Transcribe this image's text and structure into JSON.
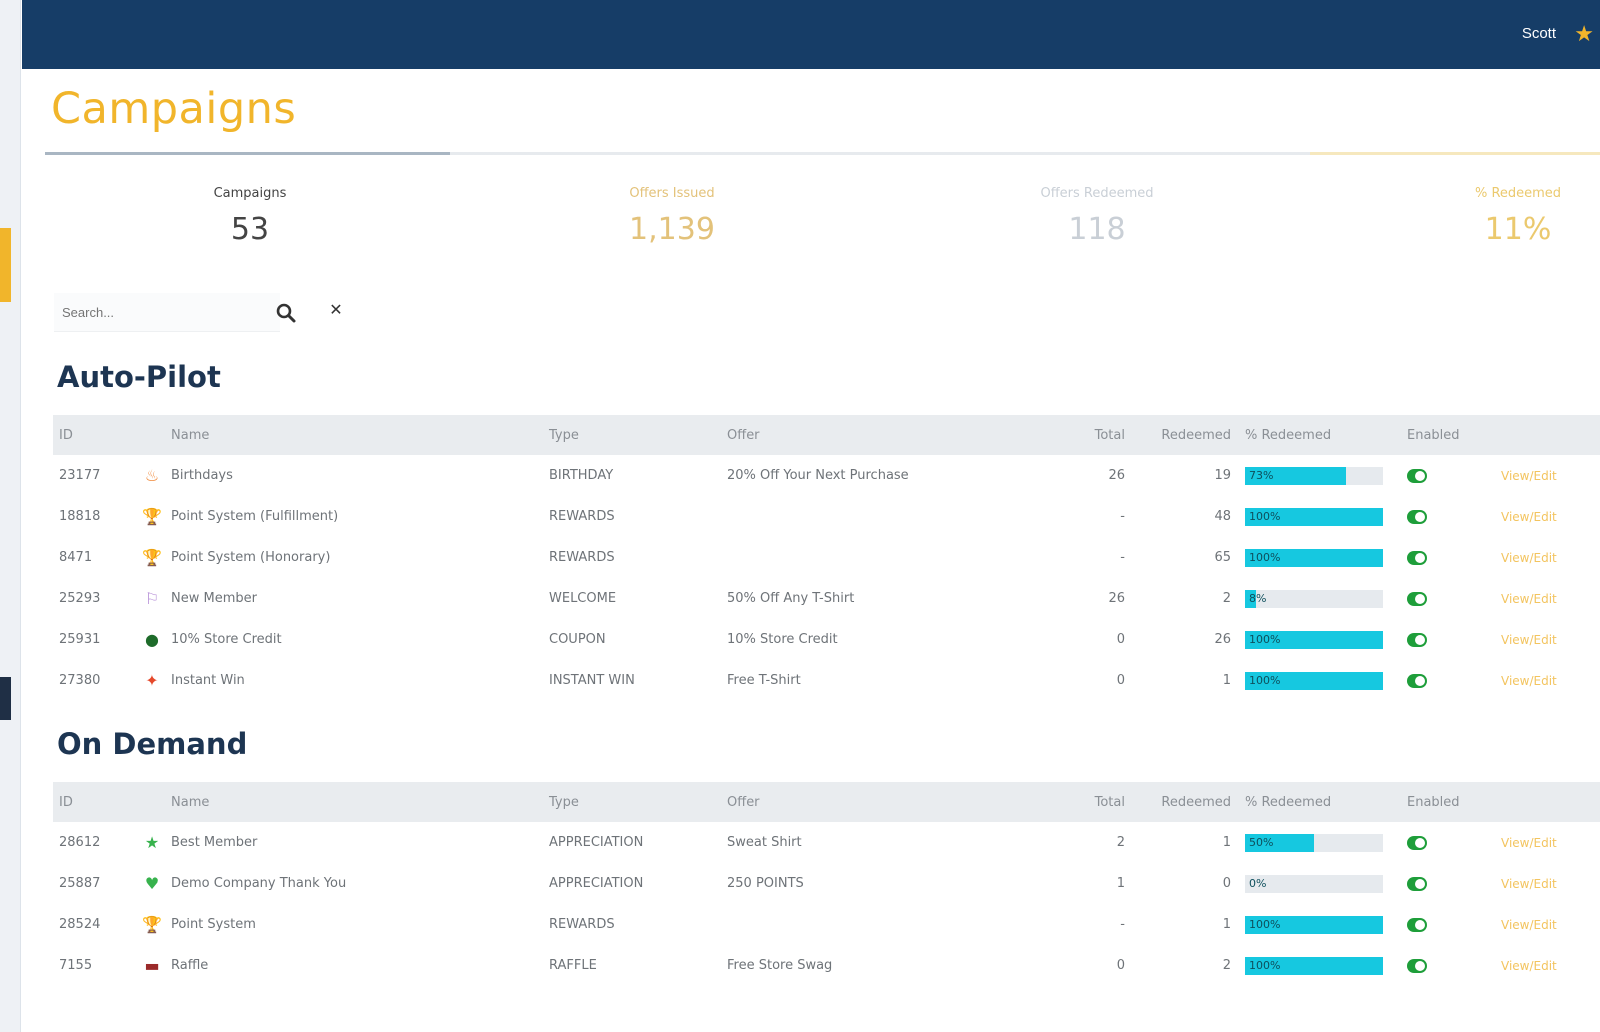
{
  "header": {
    "user_name": "Scott",
    "star_icon": "star-icon"
  },
  "page": {
    "title": "Campaigns"
  },
  "stats": [
    {
      "label": "Campaigns",
      "value": "53"
    },
    {
      "label": "Offers Issued",
      "value": "1,139"
    },
    {
      "label": "Offers Redeemed",
      "value": "118"
    },
    {
      "label": "% Redeemed",
      "value": "11%"
    }
  ],
  "search": {
    "placeholder": "Search...",
    "search_icon": "search-icon",
    "clear_icon": "close-icon"
  },
  "columns": {
    "id": "ID",
    "name": "Name",
    "type": "Type",
    "offer": "Offer",
    "total": "Total",
    "redeemed": "Redeemed",
    "pct_redeemed": "% Redeemed",
    "enabled": "Enabled"
  },
  "sections": [
    {
      "title": "Auto-Pilot",
      "rows": [
        {
          "id": "23177",
          "icon": "cake-icon",
          "icon_color": "#f08a3c",
          "name": "Birthdays",
          "type": "BIRTHDAY",
          "offer": "20% Off Your Next Purchase",
          "total": "26",
          "redeemed": "19",
          "pct": 0.73,
          "pct_label": "73%",
          "enabled": true,
          "action": "View/Edit"
        },
        {
          "id": "18818",
          "icon": "trophy-icon",
          "icon_color": "#e0a21a",
          "name": "Point System (Fulfillment)",
          "type": "REWARDS",
          "offer": "",
          "total": "-",
          "redeemed": "48",
          "pct": 1.0,
          "pct_label": "100%",
          "enabled": true,
          "action": "View/Edit"
        },
        {
          "id": "8471",
          "icon": "trophy-icon",
          "icon_color": "#e0a21a",
          "name": "Point System (Honorary)",
          "type": "REWARDS",
          "offer": "",
          "total": "-",
          "redeemed": "65",
          "pct": 1.0,
          "pct_label": "100%",
          "enabled": true,
          "action": "View/Edit"
        },
        {
          "id": "25293",
          "icon": "welcome-icon",
          "icon_color": "#b38ad6",
          "name": "New Member",
          "type": "WELCOME",
          "offer": "50% Off Any T-Shirt",
          "total": "26",
          "redeemed": "2",
          "pct": 0.08,
          "pct_label": "8%",
          "enabled": true,
          "action": "View/Edit"
        },
        {
          "id": "25931",
          "icon": "coupon-icon",
          "icon_color": "#1e6b2a",
          "name": "10% Store Credit",
          "type": "COUPON",
          "offer": "10% Store Credit",
          "total": "0",
          "redeemed": "26",
          "pct": 1.0,
          "pct_label": "100%",
          "enabled": true,
          "action": "View/Edit"
        },
        {
          "id": "27380",
          "icon": "instant-win-icon",
          "icon_color": "#e5482a",
          "name": "Instant Win",
          "type": "INSTANT WIN",
          "offer": "Free T-Shirt",
          "total": "0",
          "redeemed": "1",
          "pct": 1.0,
          "pct_label": "100%",
          "enabled": true,
          "action": "View/Edit"
        }
      ]
    },
    {
      "title": "On Demand",
      "rows": [
        {
          "id": "28612",
          "icon": "star-icon",
          "icon_color": "#37b24d",
          "name": "Best Member",
          "type": "APPRECIATION",
          "offer": "Sweat Shirt",
          "total": "2",
          "redeemed": "1",
          "pct": 0.5,
          "pct_label": "50%",
          "enabled": true,
          "action": "View/Edit"
        },
        {
          "id": "25887",
          "icon": "heart-icon",
          "icon_color": "#37b24d",
          "name": "Demo Company Thank You",
          "type": "APPRECIATION",
          "offer": "250 POINTS",
          "total": "1",
          "redeemed": "0",
          "pct": 0.0,
          "pct_label": "0%",
          "enabled": true,
          "action": "View/Edit"
        },
        {
          "id": "28524",
          "icon": "trophy-icon",
          "icon_color": "#e0a21a",
          "name": "Point System",
          "type": "REWARDS",
          "offer": "",
          "total": "-",
          "redeemed": "1",
          "pct": 1.0,
          "pct_label": "100%",
          "enabled": true,
          "action": "View/Edit"
        },
        {
          "id": "7155",
          "icon": "raffle-icon",
          "icon_color": "#9b2a2a",
          "name": "Raffle",
          "type": "RAFFLE",
          "offer": "Free Store Swag",
          "total": "0",
          "redeemed": "2",
          "pct": 1.0,
          "pct_label": "100%",
          "enabled": true,
          "action": "View/Edit"
        }
      ]
    }
  ]
}
